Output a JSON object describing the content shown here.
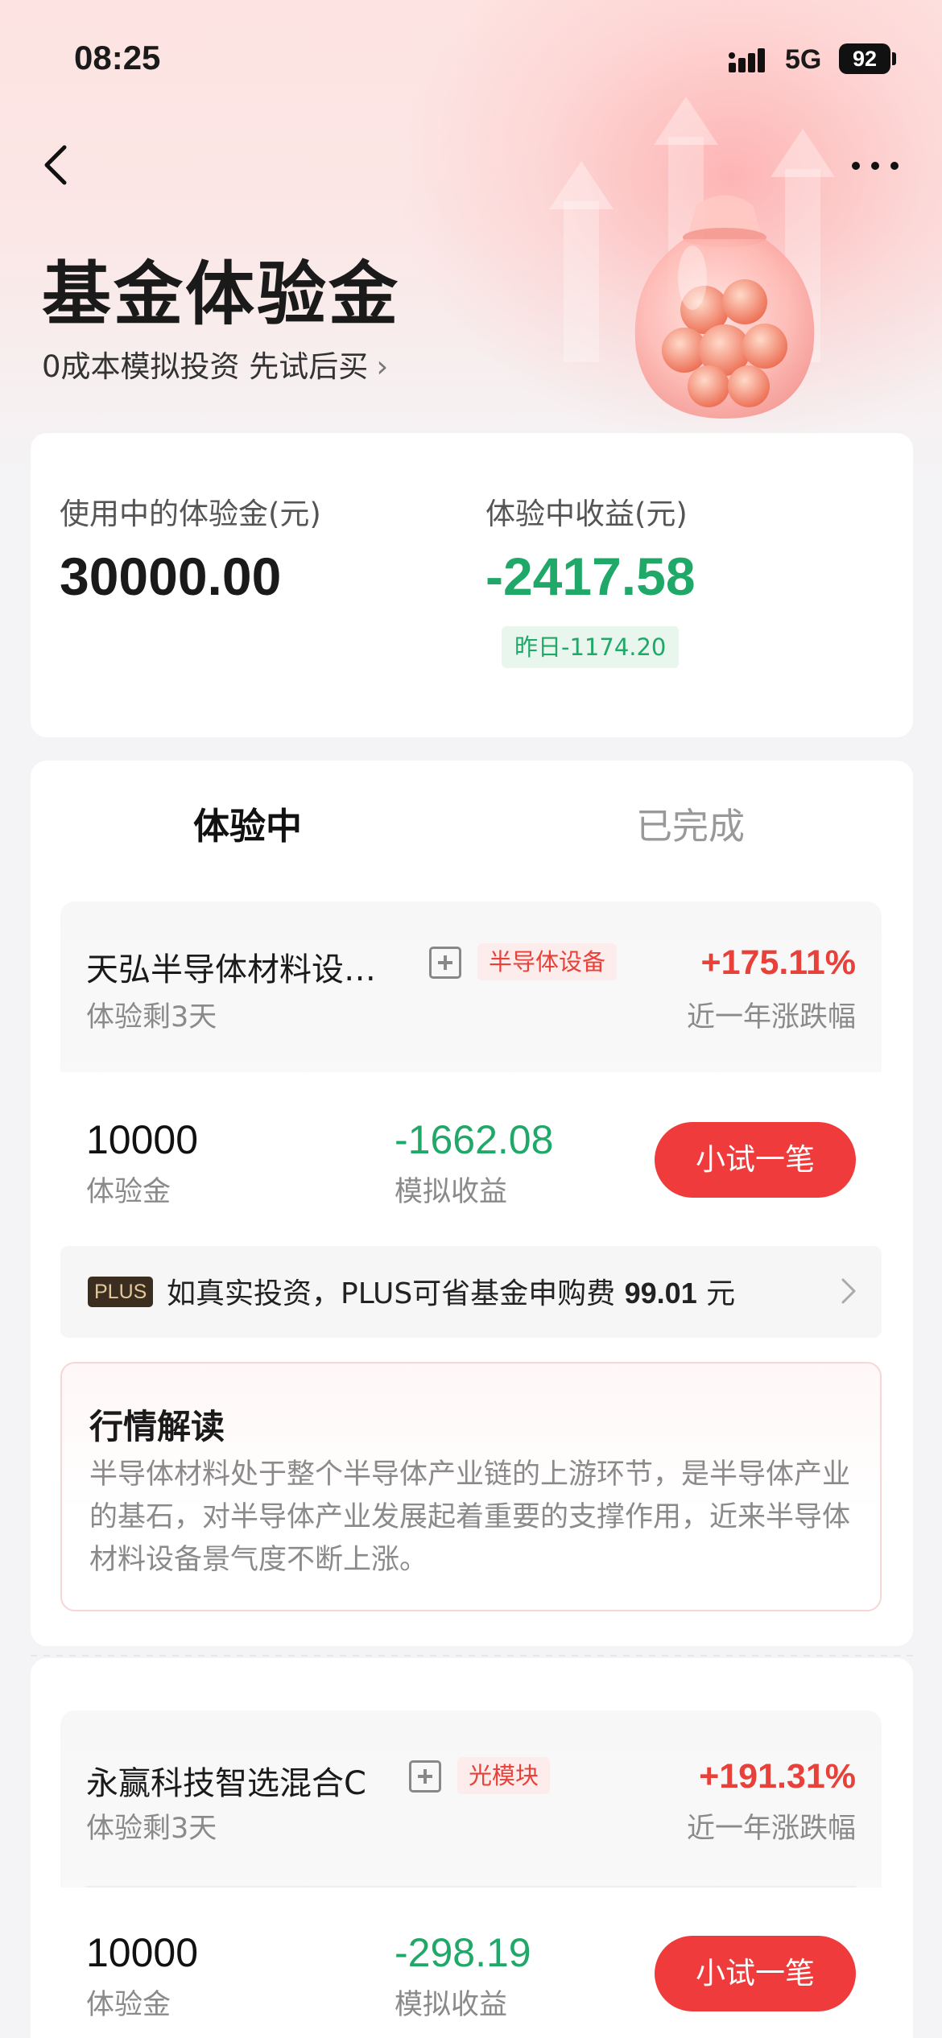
{
  "status": {
    "time": "08:25",
    "network": "5G",
    "battery": "92"
  },
  "header": {
    "title": "基金体验金",
    "subtitle": "0成本模拟投资  先试后买",
    "subtitle_chevron": "›"
  },
  "summary": {
    "in_use_label": "使用中的体验金(元)",
    "in_use_value": "30000.00",
    "profit_label": "体验中收益(元)",
    "profit_value": "-2417.58",
    "yesterday": "昨日-1174.20"
  },
  "tabs": [
    {
      "label": "体验中",
      "active": true
    },
    {
      "label": "已完成",
      "active": false
    }
  ],
  "funds": [
    {
      "name": "天弘半导体材料设…",
      "tag": "半导体设备",
      "pct": "+175.11%",
      "pct_label": "近一年涨跌幅",
      "remaining": "体验剩3天",
      "amount": "10000",
      "amount_label": "体验金",
      "profit": "-1662.08",
      "profit_label": "模拟收益",
      "button": "小试一笔"
    },
    {
      "name": "永赢科技智选混合C",
      "tag": "光模块",
      "pct": "+191.31%",
      "pct_label": "近一年涨跌幅",
      "remaining": "体验剩3天",
      "amount": "10000",
      "amount_label": "体验金",
      "profit": "-298.19",
      "profit_label": "模拟收益",
      "button": "小试一笔"
    }
  ],
  "plus_tip": {
    "badge": "PLUS",
    "text_prefix": "如真实投资，PLUS可省基金申购费 ",
    "amount": "99.01",
    "unit": " 元"
  },
  "insight": {
    "title": "行情解读",
    "body": "半导体材料处于整个半导体产业链的上游环节，是半导体产业的基石，对半导体产业发展起着重要的支撑作用，近来半导体材料设备景气度不断上涨。"
  },
  "colors": {
    "up_red": "#e8413a",
    "down_green": "#1fa868",
    "button_red": "#ef3b3b"
  }
}
